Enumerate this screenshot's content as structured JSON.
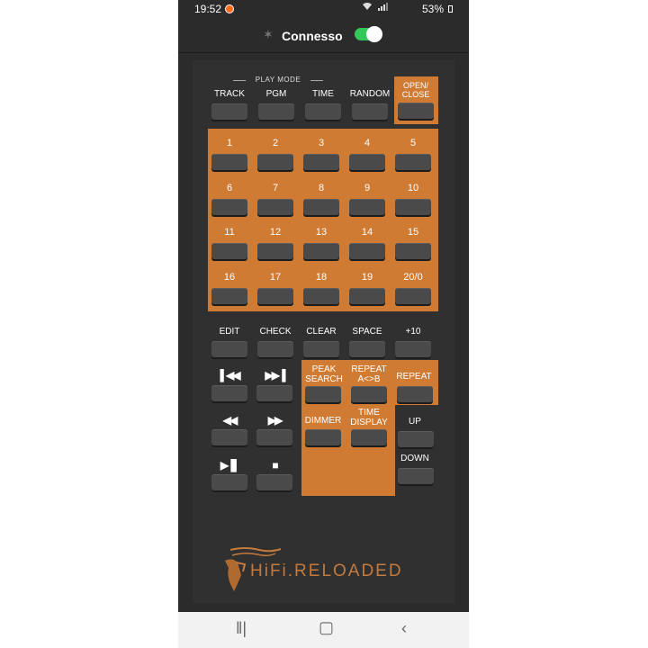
{
  "status_bar": {
    "time": "19:52",
    "battery": "53%"
  },
  "app_bar": {
    "connection_label": "Connesso",
    "toggle_on": true
  },
  "remote": {
    "play_mode_label": "PLAY MODE",
    "top_row": [
      "TRACK",
      "PGM",
      "TIME",
      "RANDOM"
    ],
    "open_close": "OPEN/\nCLOSE",
    "numbers": [
      "1",
      "2",
      "3",
      "4",
      "5",
      "6",
      "7",
      "8",
      "9",
      "10",
      "11",
      "12",
      "13",
      "14",
      "15",
      "16",
      "17",
      "18",
      "19",
      "20/0"
    ],
    "edit_row": [
      "EDIT",
      "CHECK",
      "CLEAR",
      "SPACE",
      "+10"
    ],
    "peak_search": "PEAK\nSEARCH",
    "repeat_ab": "REPEAT\nA<>B",
    "repeat": "REPEAT",
    "dimmer": "DIMMER",
    "time_display": "TIME\nDISPLAY",
    "up": "UP",
    "down": "DOWN",
    "transport_icons": [
      "skip-prev-icon",
      "skip-next-icon",
      "rewind-icon",
      "fast-forward-icon",
      "play-pause-icon",
      "stop-icon"
    ]
  },
  "logo": {
    "text": "HiFi.RELOADED"
  },
  "colors": {
    "accent": "#cf7b33",
    "panel": "#303030",
    "button": "#4a4a4a",
    "toggle": "#34c759"
  }
}
